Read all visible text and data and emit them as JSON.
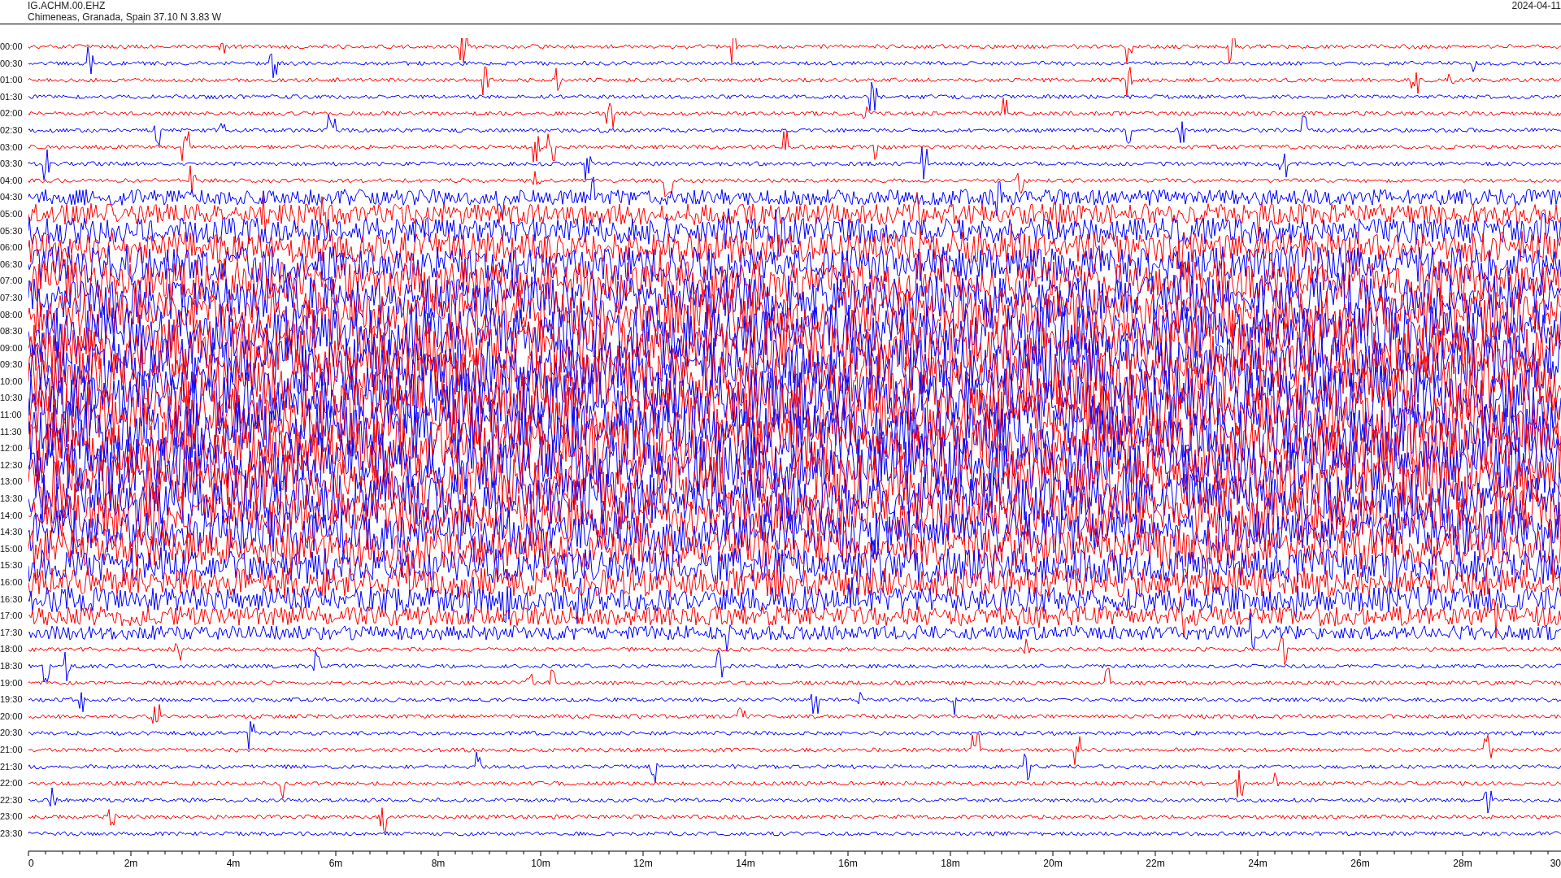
{
  "header": {
    "station": "IG.ACHM.00.EHZ",
    "location": "Chimeneas, Granada, Spain  37.10 N 3.83 W",
    "date": "2024-04-11"
  },
  "traces": [
    {
      "label": "00:00",
      "color": "#ff0000"
    },
    {
      "label": "00:30",
      "color": "#0000ff"
    },
    {
      "label": "01:00",
      "color": "#ff0000"
    },
    {
      "label": "01:30",
      "color": "#0000ff"
    },
    {
      "label": "02:00",
      "color": "#ff0000"
    },
    {
      "label": "02:30",
      "color": "#0000ff"
    },
    {
      "label": "03:00",
      "color": "#ff0000"
    },
    {
      "label": "03:30",
      "color": "#0000ff"
    },
    {
      "label": "04:00",
      "color": "#ff0000"
    },
    {
      "label": "04:30",
      "color": "#0000ff"
    },
    {
      "label": "05:00",
      "color": "#ff0000"
    },
    {
      "label": "05:30",
      "color": "#0000ff"
    },
    {
      "label": "06:00",
      "color": "#ff0000"
    },
    {
      "label": "06:30",
      "color": "#0000ff"
    },
    {
      "label": "07:00",
      "color": "#ff0000"
    },
    {
      "label": "07:30",
      "color": "#0000ff"
    },
    {
      "label": "08:00",
      "color": "#ff0000"
    },
    {
      "label": "08:30",
      "color": "#0000ff"
    },
    {
      "label": "09:00",
      "color": "#ff0000"
    },
    {
      "label": "09:30",
      "color": "#0000ff"
    },
    {
      "label": "10:00",
      "color": "#ff0000"
    },
    {
      "label": "10:30",
      "color": "#0000ff"
    },
    {
      "label": "11:00",
      "color": "#ff0000"
    },
    {
      "label": "11:30",
      "color": "#0000ff"
    },
    {
      "label": "12:00",
      "color": "#ff0000"
    },
    {
      "label": "12:30",
      "color": "#0000ff"
    },
    {
      "label": "13:00",
      "color": "#ff0000"
    },
    {
      "label": "13:30",
      "color": "#0000ff"
    },
    {
      "label": "14:00",
      "color": "#ff0000"
    },
    {
      "label": "14:30",
      "color": "#0000ff"
    },
    {
      "label": "15:00",
      "color": "#ff0000"
    },
    {
      "label": "15:30",
      "color": "#0000ff"
    },
    {
      "label": "16:00",
      "color": "#ff0000"
    },
    {
      "label": "16:30",
      "color": "#0000ff"
    },
    {
      "label": "17:00",
      "color": "#ff0000"
    },
    {
      "label": "17:30",
      "color": "#0000ff"
    },
    {
      "label": "18:00",
      "color": "#ff0000"
    },
    {
      "label": "18:30",
      "color": "#0000ff"
    },
    {
      "label": "19:00",
      "color": "#ff0000"
    },
    {
      "label": "19:30",
      "color": "#0000ff"
    },
    {
      "label": "20:00",
      "color": "#ff0000"
    },
    {
      "label": "20:30",
      "color": "#0000ff"
    },
    {
      "label": "21:00",
      "color": "#ff0000"
    },
    {
      "label": "21:30",
      "color": "#0000ff"
    },
    {
      "label": "22:00",
      "color": "#ff0000"
    },
    {
      "label": "22:30",
      "color": "#0000ff"
    },
    {
      "label": "23:00",
      "color": "#ff0000"
    },
    {
      "label": "23:30",
      "color": "#0000ff"
    }
  ],
  "x_axis": {
    "ticks": [
      "0",
      "2m",
      "4m",
      "6m",
      "8m",
      "10m",
      "12m",
      "14m",
      "16m",
      "18m",
      "20m",
      "22m",
      "24m",
      "26m",
      "28m",
      "30"
    ]
  }
}
